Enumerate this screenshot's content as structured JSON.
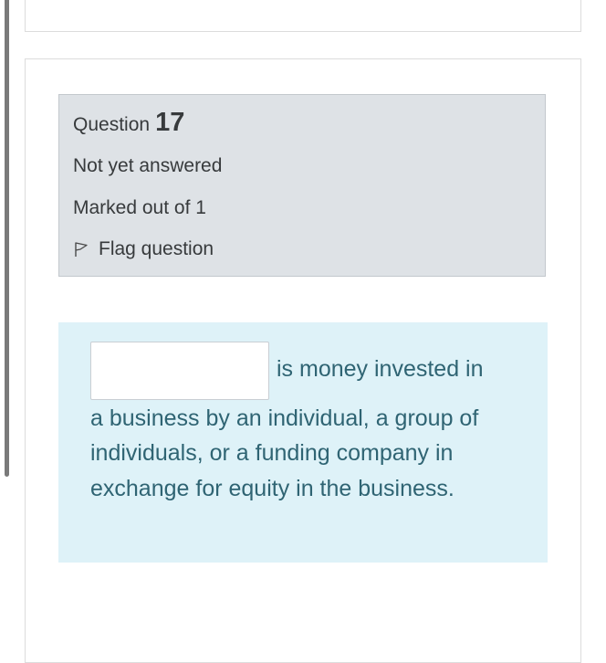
{
  "question": {
    "label": "Question",
    "number": "17",
    "state": "Not yet answered",
    "grade": "Marked out of 1",
    "flag_label": "Flag question",
    "flag_icon": "flag-outline-icon"
  },
  "formulation": {
    "answer_value": "",
    "text_lines": [
      "is money invested in",
      "a business by an individual, a group of",
      "individuals, or a funding company in",
      "exchange for equity in the business."
    ]
  },
  "colors": {
    "info_bg": "#dee2e6",
    "formulation_bg": "#def2f8",
    "formulation_text": "#2f6473",
    "body_text": "#373a3c"
  }
}
